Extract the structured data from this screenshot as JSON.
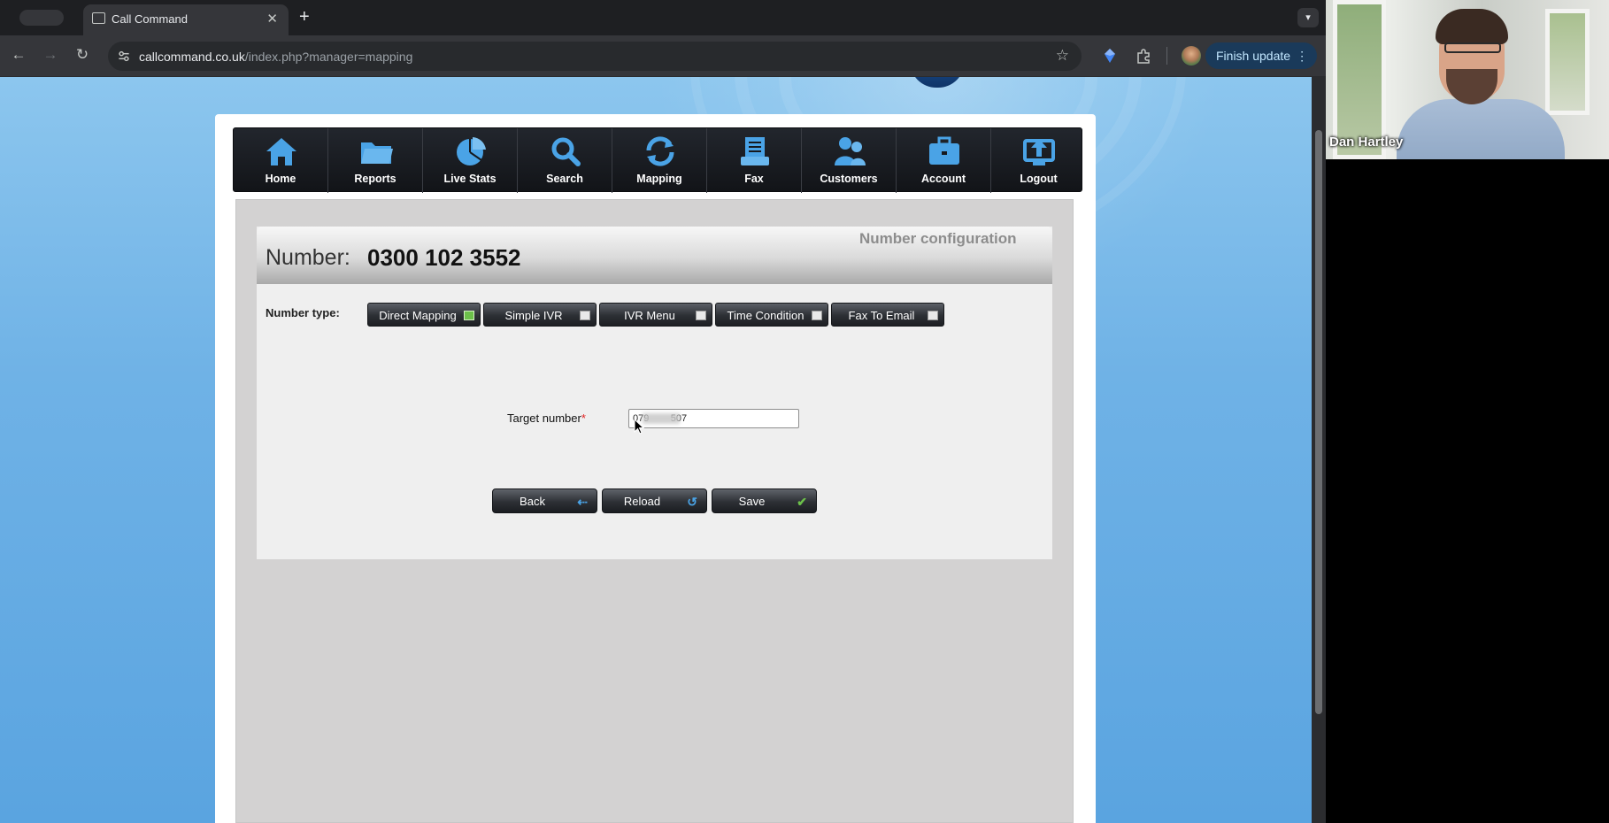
{
  "browser": {
    "tab_title": "Call Command",
    "url_host": "callcommand.co.uk",
    "url_path": "/index.php?manager=mapping",
    "finish_update_label": "Finish update"
  },
  "nav": {
    "items": [
      {
        "label": "Home",
        "icon": "home-icon"
      },
      {
        "label": "Reports",
        "icon": "folder-icon"
      },
      {
        "label": "Live Stats",
        "icon": "pie-chart-icon"
      },
      {
        "label": "Search",
        "icon": "search-icon"
      },
      {
        "label": "Mapping",
        "icon": "refresh-icon"
      },
      {
        "label": "Fax",
        "icon": "printer-icon"
      },
      {
        "label": "Customers",
        "icon": "users-icon"
      },
      {
        "label": "Account",
        "icon": "briefcase-icon"
      },
      {
        "label": "Logout",
        "icon": "upload-icon"
      }
    ]
  },
  "config": {
    "section_title": "Number configuration",
    "number_label": "Number:",
    "number_value": "0300 102 3552",
    "number_type_label": "Number type:",
    "number_types": [
      {
        "label": "Direct Mapping",
        "selected": true
      },
      {
        "label": "Simple IVR",
        "selected": false
      },
      {
        "label": "IVR Menu",
        "selected": false
      },
      {
        "label": "Time Condition",
        "selected": false
      },
      {
        "label": "Fax To Email",
        "selected": false
      }
    ],
    "target_label": "Target number",
    "target_required_mark": "*",
    "target_value": "079        507"
  },
  "actions": {
    "back_label": "Back",
    "reload_label": "Reload",
    "save_label": "Save"
  },
  "video": {
    "participant_name": "Dan Hartley"
  },
  "colors": {
    "nav_bg": "#1a1d22",
    "nav_icon": "#4aa3e6",
    "selected_type": "#6cc04a",
    "page_bg": "#6fb2e6"
  }
}
